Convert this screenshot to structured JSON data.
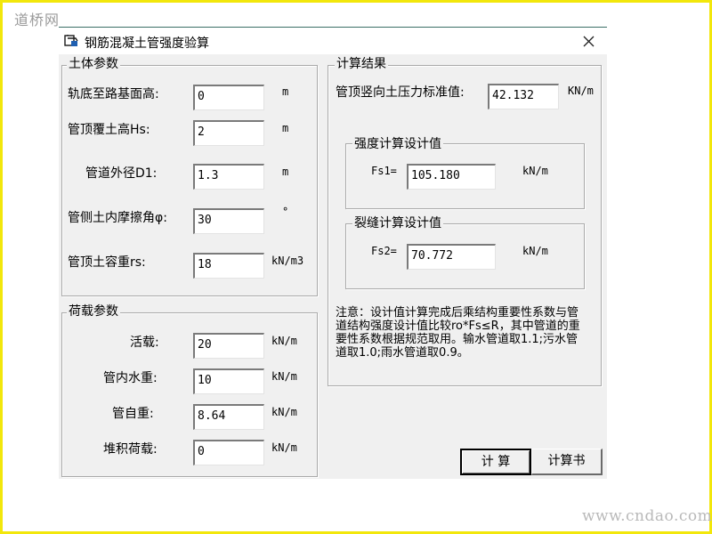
{
  "watermark": {
    "top": "道桥网",
    "bottom": "www.cndao.com"
  },
  "window": {
    "title": "钢筋混凝土管强度验算",
    "close_glyph": "✕"
  },
  "soil": {
    "group_title": "土体参数",
    "fields": [
      {
        "label": "轨底至路基面高:",
        "value": "0",
        "unit": "m"
      },
      {
        "label": "管顶覆土高Hs:",
        "value": "2",
        "unit": "m"
      },
      {
        "label": "管道外径D1:",
        "value": "1.3",
        "unit": "m"
      },
      {
        "label": "管侧土内摩擦角φ:",
        "value": "30",
        "unit": "°"
      },
      {
        "label": "管顶土容重rs:",
        "value": "18",
        "unit": "kN/m3"
      }
    ]
  },
  "load": {
    "group_title": "荷载参数",
    "fields": [
      {
        "label": "活载:",
        "value": "20",
        "unit": "kN/m"
      },
      {
        "label": "管内水重:",
        "value": "10",
        "unit": "kN/m"
      },
      {
        "label": "管自重:",
        "value": "8.64",
        "unit": "kN/m"
      },
      {
        "label": "堆积荷载:",
        "value": "0",
        "unit": "kN/m"
      }
    ]
  },
  "result": {
    "group_title": "计算结果",
    "pressure_label": "管顶竖向土压力标准值:",
    "pressure_value": "42.132",
    "pressure_unit": "KN/m",
    "strength": {
      "group_title": "强度计算设计值",
      "label": "Fs1=",
      "value": "105.180",
      "unit": "kN/m"
    },
    "crack": {
      "group_title": "裂缝计算设计值",
      "label": "Fs2=",
      "value": "70.772",
      "unit": "kN/m"
    },
    "note": "注意：设计值计算完成后乘结构重要性系数与管道结构强度设计值比较ro*Fs≤R，其中管道的重要性系数根据规范取用。输水管道取1.1;污水管道取1.0;雨水管道取0.9。"
  },
  "buttons": {
    "calculate": "计 算",
    "report": "计算书"
  }
}
